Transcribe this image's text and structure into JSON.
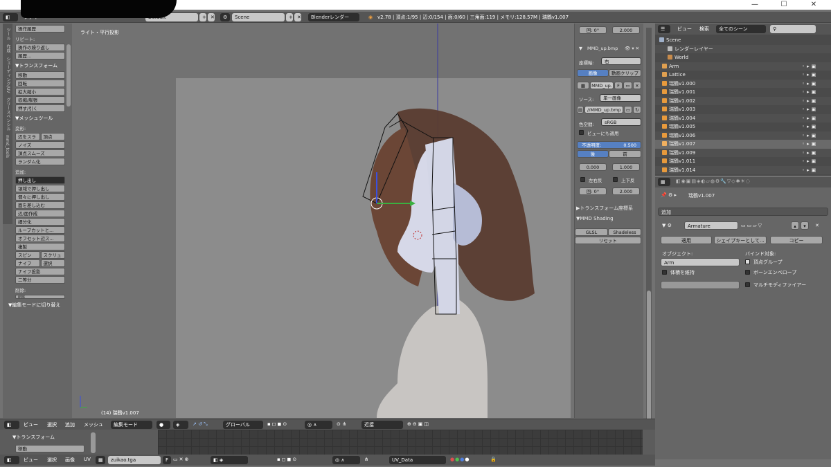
{
  "window": {
    "minimize": "—",
    "maximize": "☐",
    "close": "✕"
  },
  "topbar": {
    "menu_file": "ファイル",
    "screen": "Default",
    "scene": "Scene",
    "renderer": "Blenderレンダー",
    "stats": "v2.78 | 頂点:1/95 | 辺:0/154 | 面:0/60 | 三角面:119 | メモリ:128.57M | 瑞鶴v1.007"
  },
  "toolshelf": {
    "tabs": [
      "ツール",
      "作成",
      "シェーディング/UV",
      "グリースペンシル",
      "mmd_tools"
    ],
    "history_btn": "操作履歴",
    "repeat_lbl": "リピート:",
    "repeat_last": "操作の繰り返し",
    "history": "履歴...",
    "transform_hdr": "▼トランスフォーム",
    "move": "移動",
    "rotate": "回転",
    "scale": "拡大縮小",
    "shrink": "収縮/膨張",
    "push": "押す/引く",
    "meshtools_hdr": "▼メッシュツール",
    "deform_lbl": "変形:",
    "slide_edge": "辺をスラ",
    "slide_vert": "頂点",
    "noise": "ノイズ",
    "smooth_vert": "頂点スムーズ",
    "randomize": "ランダム化",
    "add_lbl": "追加:",
    "extrude": "押し出し",
    "extrude_region": "領域で押し出し",
    "extrude_individual": "個々に押し出し",
    "inset": "面を差し込む",
    "edge_face": "辺/面作成",
    "subdivide": "細分化",
    "loopcut": "ループカットと...",
    "offset_edge": "オフセット辺ス...",
    "duplicate": "複製",
    "spin": "スピン",
    "screw": "スクリュ",
    "knife": "ナイフ",
    "select": "選択",
    "knife_project": "ナイフ投影",
    "bisect": "二等分",
    "delete_lbl": "削除:",
    "delete_sel": "削除",
    "editmode_toggle": "▼編集モードに切り替え"
  },
  "viewport": {
    "label": "ライト・平行投影",
    "object": "(14) 瑞鶴v1.007"
  },
  "npanel": {
    "rot_lbl": "回: 0°",
    "rot_val": "2.000",
    "image_name": "MMD_up.bmp",
    "axis_lbl": "座標軸:",
    "axis_val": "右",
    "tab_image": "画像",
    "tab_movie": "動画クリップ",
    "img_field": "MMD_up.",
    "img_f": "F",
    "source_lbl": "ソース:",
    "source_val": "単一画像",
    "path": "//MMD_up.bmp",
    "colorspace_lbl": "色空間:",
    "colorspace_val": "sRGB",
    "view_too": "ビューにも適用",
    "opacity_lbl": "不透明度:",
    "opacity_val": "0.500",
    "back": "後",
    "front": "前",
    "offset_x": "0.000",
    "offset_y": "1.000",
    "flip_x": "左右反",
    "flip_y": "上下反",
    "rot2_lbl": "回: 0°",
    "rot2_val": "2.000",
    "transform_orient": "▶トランスフォーム座標系",
    "mmd_shading": "▼MMD Shading",
    "glsl": "GLSL",
    "shadeless": "Shadeless",
    "reset": "リセット"
  },
  "outliner": {
    "view": "ビュー",
    "search": "検索",
    "filter": "全てのシーン",
    "rows": [
      {
        "name": "Scene",
        "color": "#9fb0c9"
      },
      {
        "name": "レンダーレイヤー",
        "color": "#bbbbbb"
      },
      {
        "name": "World",
        "color": "#c88b4b"
      },
      {
        "name": "Arm",
        "color": "#e0a050"
      },
      {
        "name": "Lattice",
        "color": "#e0a050"
      },
      {
        "name": "瑞鶴v1.000",
        "color": "#e89a3c"
      },
      {
        "name": "瑞鶴v1.001",
        "color": "#e89a3c"
      },
      {
        "name": "瑞鶴v1.002",
        "color": "#e89a3c"
      },
      {
        "name": "瑞鶴v1.003",
        "color": "#e89a3c"
      },
      {
        "name": "瑞鶴v1.004",
        "color": "#e89a3c"
      },
      {
        "name": "瑞鶴v1.005",
        "color": "#e89a3c"
      },
      {
        "name": "瑞鶴v1.006",
        "color": "#e89a3c"
      },
      {
        "name": "瑞鶴v1.007",
        "color": "#f0b060"
      },
      {
        "name": "瑞鶴v1.009",
        "color": "#e89a3c"
      },
      {
        "name": "瑞鶴v1.011",
        "color": "#e89a3c"
      },
      {
        "name": "瑞鶴v1.014",
        "color": "#e89a3c"
      }
    ]
  },
  "properties": {
    "object_name": "瑞鶴v1.007",
    "add_modifier": "追加",
    "modifier_name": "Armature",
    "apply": "適用",
    "shapekey": "シェイプキーとして...",
    "copy": "コピー",
    "object_lbl": "オブジェクト:",
    "object_val": "Arm",
    "bind_lbl": "バインド対象:",
    "vgroups": "頂点グループ",
    "preserve_vol": "体積を維持",
    "bone_env": "ボーンエンベロープ",
    "multi_mod": "マルチモディファイアー"
  },
  "vp_header": {
    "view": "ビュー",
    "select": "選択",
    "add": "追加",
    "mesh": "メッシュ",
    "mode": "編集モード",
    "orient": "グローバル",
    "snap": "近接"
  },
  "uv_side": {
    "transform": "▼トランスフォーム",
    "move": "移動"
  },
  "bot_header": {
    "view": "ビュー",
    "select": "選択",
    "image": "画像",
    "uv": "UV",
    "image_name": "zuikao.tga",
    "f": "F",
    "uvmap": "UV_Data"
  }
}
